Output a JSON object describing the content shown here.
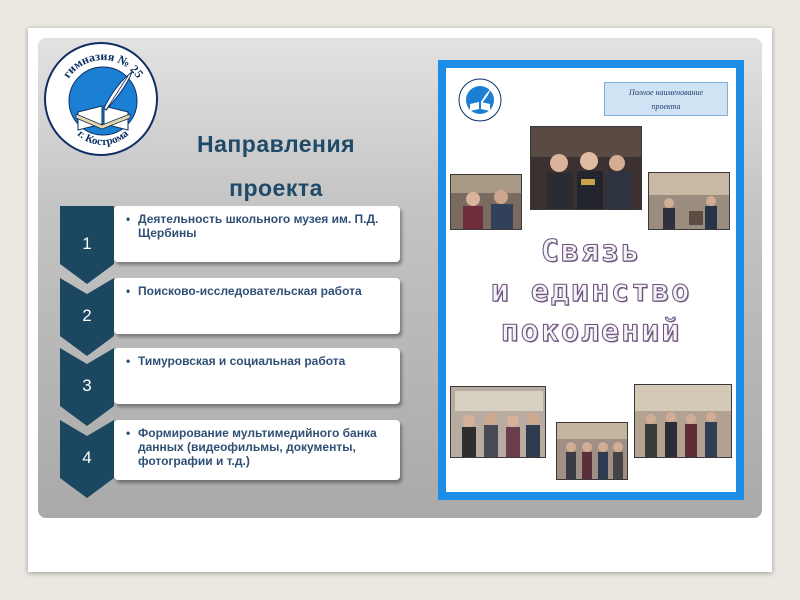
{
  "logo": {
    "top_text": "гимназия № 25",
    "bottom_text": "г. Кострома",
    "icon": "book-quill-icon"
  },
  "title": {
    "line1": "Направления",
    "line2": "проекта"
  },
  "steps": [
    {
      "number": "1",
      "text": "Деятельность школьного музея им. П.Д. Щербины"
    },
    {
      "number": "2",
      "text": "Поисково-исследовательская работа"
    },
    {
      "number": "3",
      "text": "Тимуровская и социальная работа"
    },
    {
      "number": "4",
      "text": "Формирование мультимедийного банка данных (видеофильмы, документы, фотографии и т.д.)"
    }
  ],
  "poster": {
    "header_line1": "Полное наименование",
    "header_line2": "проекта",
    "text_line1": "Связь",
    "text_line2": "и единство",
    "text_line3": "поколений"
  },
  "colors": {
    "accent_dark": "#0e2f63",
    "title": "#1f4a68",
    "chevron": "#1b4761",
    "poster_border": "#1d8ee6"
  }
}
